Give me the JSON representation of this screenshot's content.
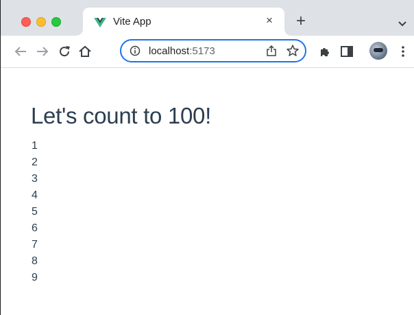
{
  "browser": {
    "tab": {
      "title": "Vite App",
      "close_glyph": "×",
      "favicon": "vue-logo-icon"
    },
    "new_tab_glyph": "+",
    "address": {
      "host": "localhost",
      "port": ":5173"
    },
    "colors": {
      "tabstrip": "#dee1e6",
      "omnibox_border": "#1a73e8",
      "vue_green": "#42b883",
      "vue_dark": "#35495e"
    }
  },
  "page": {
    "heading": "Let's count to 100!",
    "numbers": [
      "1",
      "2",
      "3",
      "4",
      "5",
      "6",
      "7",
      "8",
      "9"
    ]
  }
}
